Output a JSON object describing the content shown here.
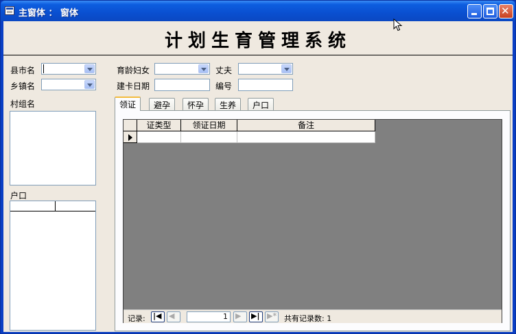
{
  "window": {
    "title": "主窗体 ： 窗体"
  },
  "header": {
    "title": "计划生育管理系统"
  },
  "filters": {
    "county_label": "县市名",
    "town_label": "乡镇名",
    "women_label": "育龄妇女",
    "husband_label": "丈夫",
    "card_date_label": "建卡日期",
    "number_label": "编号"
  },
  "left_panel": {
    "village_label": "村组名",
    "household_label": "户口"
  },
  "tabs": [
    {
      "label": "领证"
    },
    {
      "label": "避孕"
    },
    {
      "label": "怀孕"
    },
    {
      "label": "生养"
    },
    {
      "label": "户口"
    }
  ],
  "datagrid": {
    "columns": [
      "证类型",
      "领证日期",
      "备注"
    ]
  },
  "navigator": {
    "record_label": "记录:",
    "current": "1",
    "total_label": "共有记录数: 1"
  },
  "icons": {
    "first": "first-record-icon",
    "prev": "prev-record-icon",
    "next": "next-record-icon",
    "last": "last-record-icon",
    "new": "new-record-icon"
  }
}
